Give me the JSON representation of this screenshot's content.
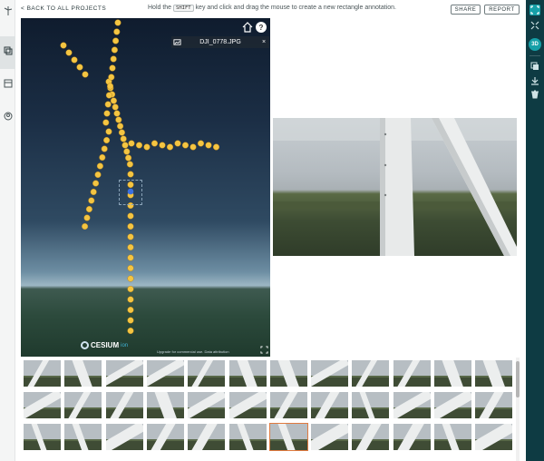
{
  "header": {
    "back_link": "< BACK TO ALL PROJECTS",
    "hint_before": "Hold the",
    "hint_key": "SHIFT",
    "hint_after": "key and click and drag the mouse to create a new rectangle annotation.",
    "share_label": "SHARE",
    "report_label": "REPORT"
  },
  "left_rail": {
    "icons": [
      "wind-turbine-icon",
      "layers-icon",
      "panel-icon",
      "user-circle-icon"
    ]
  },
  "right_bar": {
    "icons": [
      "expand-icon",
      "scan-icon",
      "3d-badge",
      "gallery-icon",
      "download-icon",
      "trash-icon"
    ],
    "badge_3d": "3D"
  },
  "viewer": {
    "file_name": "DJI_0778.JPG",
    "close": "×",
    "help": "?",
    "logo_text": "CESIUM",
    "logo_sub": "ion",
    "attribution": "Upgrade for commercial use. Data attribution"
  },
  "colors": {
    "accent": "#16a0a8",
    "right_bar": "#0e3b43",
    "points": "#f4c542",
    "selected_thumb": "#e07a3f"
  },
  "thumbnails": {
    "rows": 3,
    "columns": 12,
    "selected_row": 3,
    "selected_column": 7
  }
}
